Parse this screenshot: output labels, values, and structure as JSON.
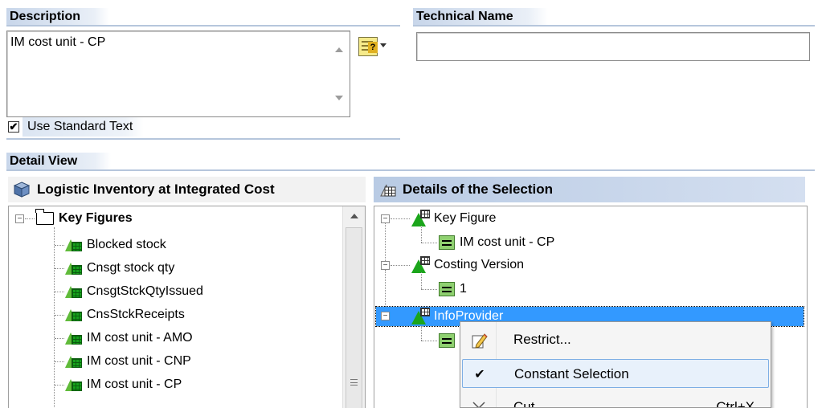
{
  "description": {
    "label": "Description",
    "value": "IM cost unit - CP"
  },
  "technical_name": {
    "label": "Technical Name",
    "value": ""
  },
  "use_standard_text": {
    "label": "Use Standard Text",
    "checked": true,
    "check_glyph": "✔"
  },
  "detail_view": {
    "label": "Detail View"
  },
  "left_panel": {
    "title": "Logistic Inventory at Integrated Cost",
    "folder_label": "Key Figures",
    "items": [
      {
        "label": "Blocked stock"
      },
      {
        "label": "Cnsgt stock qty"
      },
      {
        "label": "CnsgtStckQtyIssued"
      },
      {
        "label": "CnsStckReceipts"
      },
      {
        "label": "IM cost unit - AMO"
      },
      {
        "label": "IM cost unit - CNP"
      },
      {
        "label": "IM cost unit - CP"
      }
    ]
  },
  "right_panel": {
    "title": "Details of the Selection",
    "nodes": [
      {
        "label": "Key Figure",
        "child": "IM cost unit - CP"
      },
      {
        "label": "Costing Version",
        "child": "1"
      },
      {
        "label": "InfoProvider",
        "child": ""
      }
    ]
  },
  "context_menu": {
    "items": [
      {
        "label": "Restrict...",
        "icon": "pencil-icon"
      },
      {
        "label": "Constant Selection",
        "icon": "checkmark-icon",
        "checked_glyph": "✔"
      },
      {
        "label": "Cut",
        "shortcut": "Ctrl+X",
        "icon": "scissors-icon"
      }
    ]
  },
  "colors": {
    "section_header": "#c8d6ea",
    "selection_highlight": "#3399ff",
    "details_header": "#b9cbe4",
    "key_figure_green": "#15a21c"
  }
}
